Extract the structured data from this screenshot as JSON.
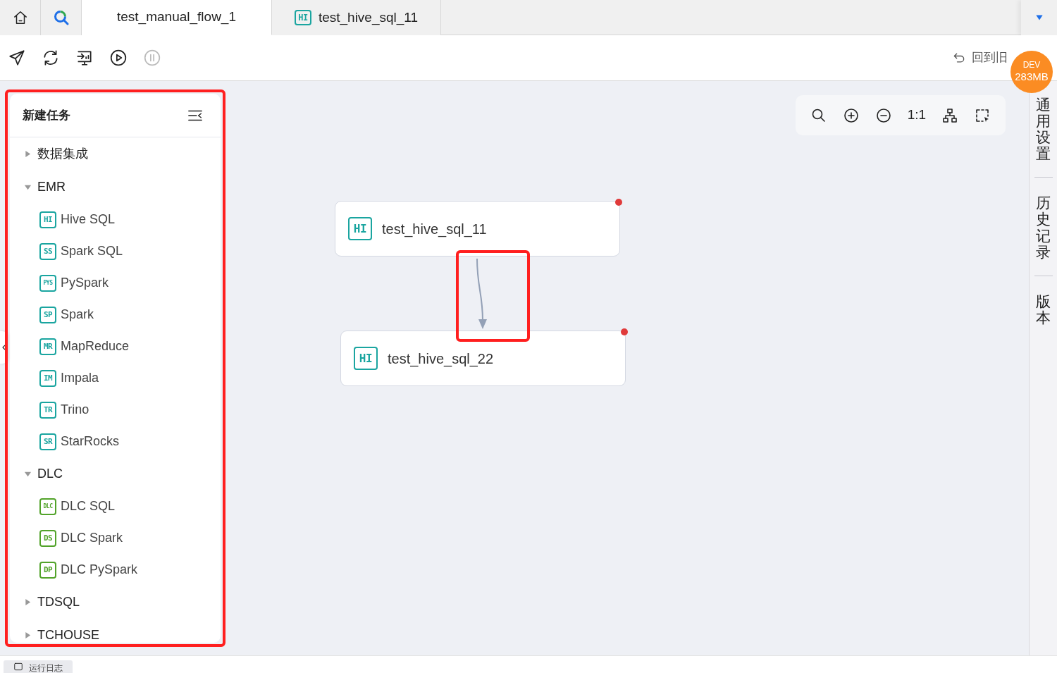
{
  "tabs": [
    {
      "kind": "home",
      "selected": false
    },
    {
      "kind": "search",
      "selected": false
    },
    {
      "kind": "file",
      "label": "test_manual_flow_1",
      "selected": true
    },
    {
      "kind": "task",
      "label": "test_hive_sql_11",
      "badge": "HI",
      "color": "#1aa5a0",
      "selected": false
    }
  ],
  "toolbar": [
    {
      "kind": "send",
      "disabled": false
    },
    {
      "kind": "refresh",
      "disabled": false
    },
    {
      "kind": "monitor",
      "disabled": false
    },
    {
      "kind": "play",
      "disabled": false
    },
    {
      "kind": "pause",
      "disabled": true
    }
  ],
  "revert_link": {
    "label": "回到旧"
  },
  "env_badge": {
    "env": "DEV",
    "memory": "283MB"
  },
  "sidebar": {
    "title": "新建任务",
    "groups": [
      {
        "label": "数据集成",
        "expanded": false
      },
      {
        "label": "EMR",
        "expanded": true,
        "children": [
          {
            "badge": "HI",
            "label": "Hive SQL",
            "color": "#1aa5a0"
          },
          {
            "badge": "SS",
            "label": "Spark SQL",
            "color": "#1aa5a0"
          },
          {
            "badge": "PYS",
            "label": "PySpark",
            "color": "#1aa5a0"
          },
          {
            "badge": "SP",
            "label": "Spark",
            "color": "#1aa5a0"
          },
          {
            "badge": "MR",
            "label": "MapReduce",
            "color": "#1aa5a0"
          },
          {
            "badge": "IM",
            "label": "Impala",
            "color": "#1aa5a0"
          },
          {
            "badge": "TR",
            "label": "Trino",
            "color": "#1aa5a0"
          },
          {
            "badge": "SR",
            "label": "StarRocks",
            "color": "#1aa5a0"
          }
        ]
      },
      {
        "label": "DLC",
        "expanded": true,
        "children": [
          {
            "badge": "DLC",
            "label": "DLC SQL",
            "color": "#52a32a"
          },
          {
            "badge": "DS",
            "label": "DLC Spark",
            "color": "#52a32a"
          },
          {
            "badge": "DP",
            "label": "DLC PySpark",
            "color": "#52a32a"
          }
        ]
      },
      {
        "label": "TDSQL",
        "expanded": false
      },
      {
        "label": "TCHOUSE",
        "expanded": false
      }
    ],
    "highlighted": true
  },
  "canvas": {
    "zoom_tools": [
      {
        "kind": "search"
      },
      {
        "kind": "zoom-in"
      },
      {
        "kind": "zoom-out"
      },
      {
        "kind": "actual",
        "label": "1:1"
      },
      {
        "kind": "layout"
      },
      {
        "kind": "select"
      }
    ],
    "nodes": [
      {
        "badge": "HI",
        "label": "test_hive_sql_11",
        "color": "#1aa5a0",
        "alert": true
      },
      {
        "badge": "HI",
        "label": "test_hive_sql_22",
        "color": "#1aa5a0",
        "alert": true
      }
    ],
    "edges": [
      {
        "kind": "arrow",
        "highlighted": true
      }
    ]
  },
  "right_rail": [
    {
      "label": "通用设置"
    },
    {
      "label": "历史记录"
    },
    {
      "label": "版本"
    }
  ],
  "bottom_bar": {
    "tab": "运行日志"
  }
}
